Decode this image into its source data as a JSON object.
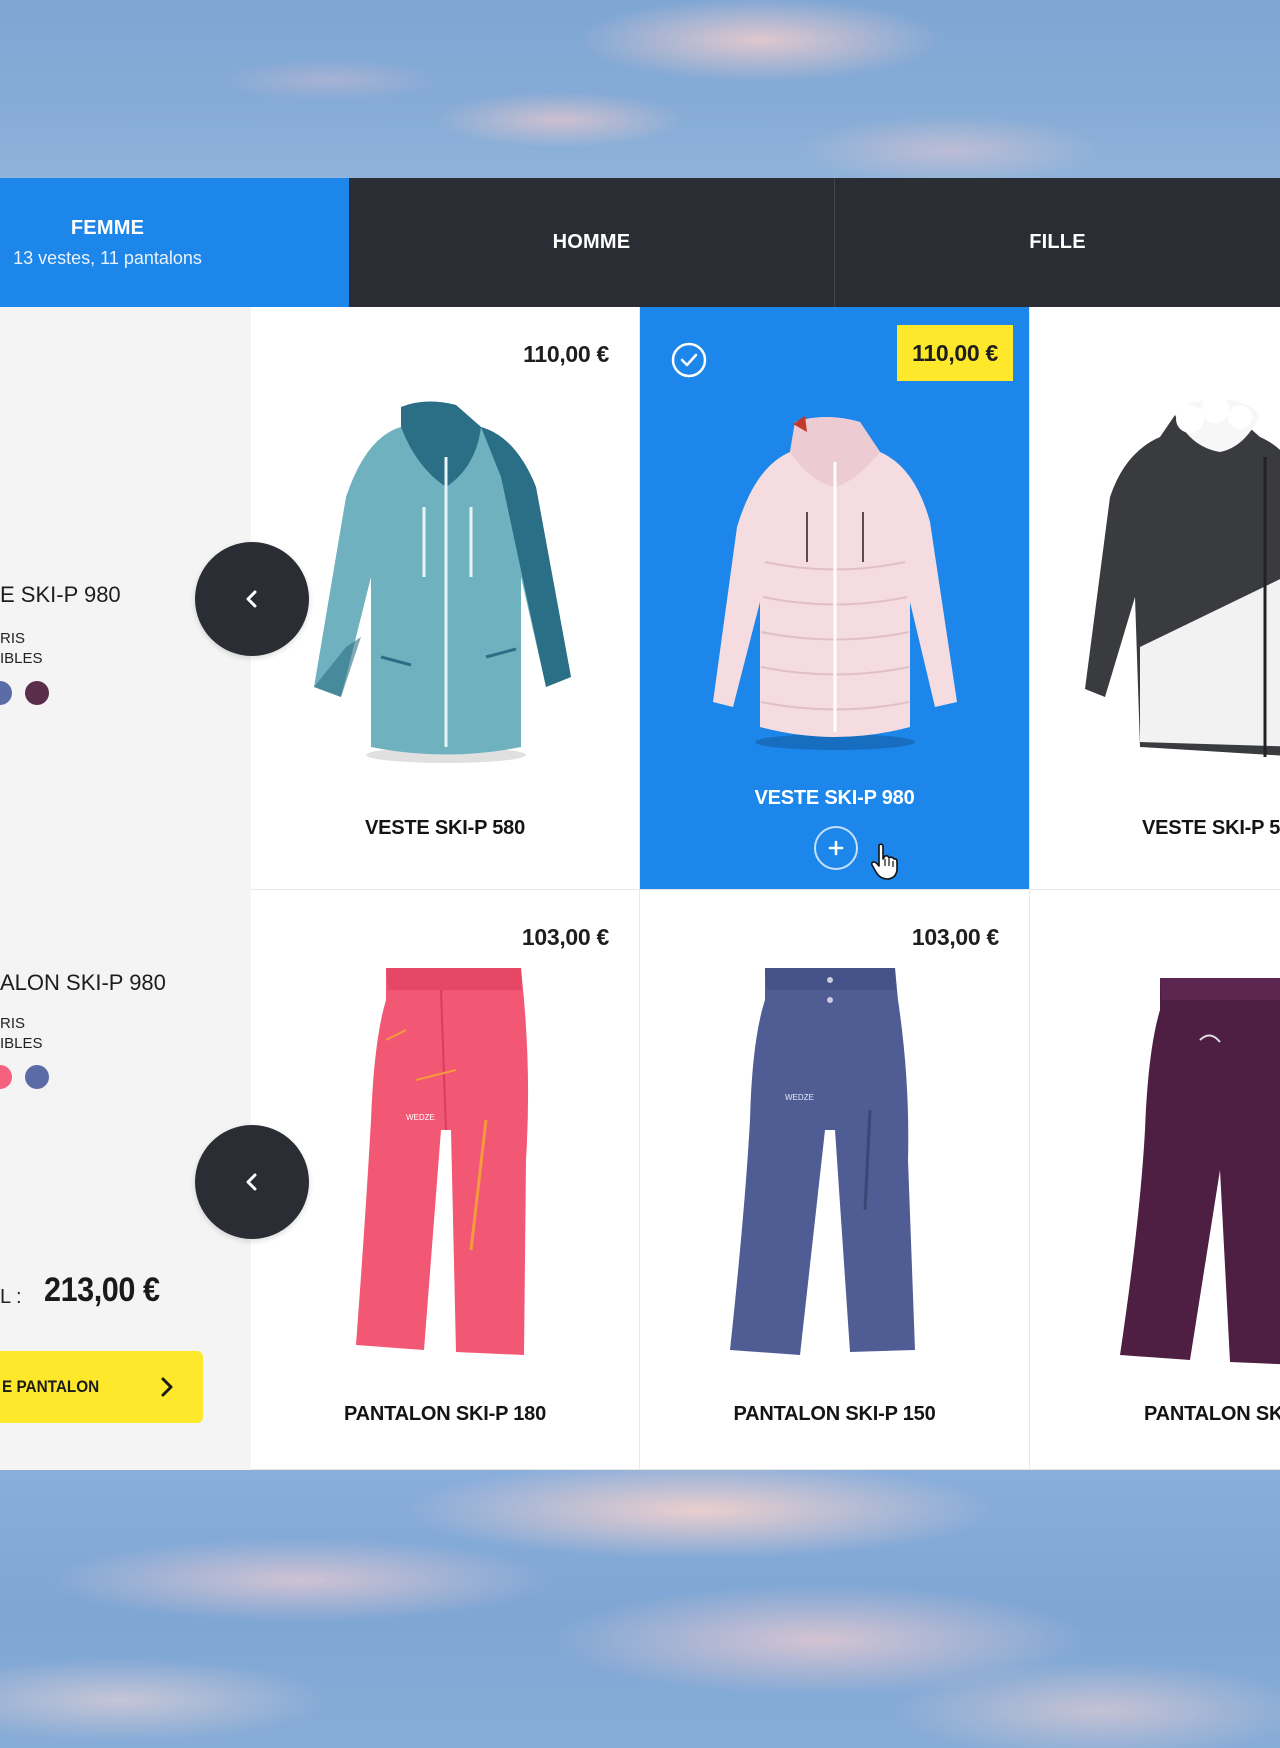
{
  "tabs": [
    {
      "label": "FEMME",
      "sub": "13 vestes, 11 pantalons",
      "active": true
    },
    {
      "label": "HOMME"
    },
    {
      "label": "FILLE"
    }
  ],
  "summary": {
    "jacket_name": "E SKI-P 980",
    "jacket_colors_line1": "RIS",
    "jacket_colors_line2": "IBLES",
    "jacket_colors": [
      "#5b6ba8",
      "#5a2d4a"
    ],
    "pants_name": "ALON SKI-P 980",
    "pants_colors_line1": "RIS",
    "pants_colors_line2": "IBLES",
    "pants_colors": [
      "#f4617f",
      "#5b6ba8"
    ],
    "total_label": "L :",
    "total_value": "213,00 €",
    "cta_label": "E PANTALON"
  },
  "jackets": [
    {
      "name": "VESTE SKI-P 580",
      "price": "110,00 €",
      "color": "#6fb1bf",
      "accent": "#2b6f86"
    },
    {
      "name": "VESTE SKI-P 980",
      "price": "110,00 €",
      "selected": true,
      "color": "#f4dce1",
      "accent": "#e9c9cf"
    },
    {
      "name": "VESTE SKI-P 5",
      "color": "#3a3b3e",
      "accent": "#f2f2f2"
    }
  ],
  "pants": [
    {
      "name": "PANTALON SKI-P 180",
      "price": "103,00 €",
      "color": "#f25773"
    },
    {
      "name": "PANTALON SKI-P 150",
      "price": "103,00 €",
      "color": "#4f5d94"
    },
    {
      "name": "PANTALON SKI-P",
      "color": "#4f1f43"
    }
  ],
  "colors": {
    "accent_blue": "#1d86ea",
    "dark": "#2a2d33",
    "yellow": "#fde82b"
  },
  "icons": {
    "arrow": "chevron-left-icon",
    "check": "check-circle-icon",
    "plus": "plus-icon",
    "cta": "chevron-right-icon",
    "cursor": "hand-cursor-icon"
  }
}
